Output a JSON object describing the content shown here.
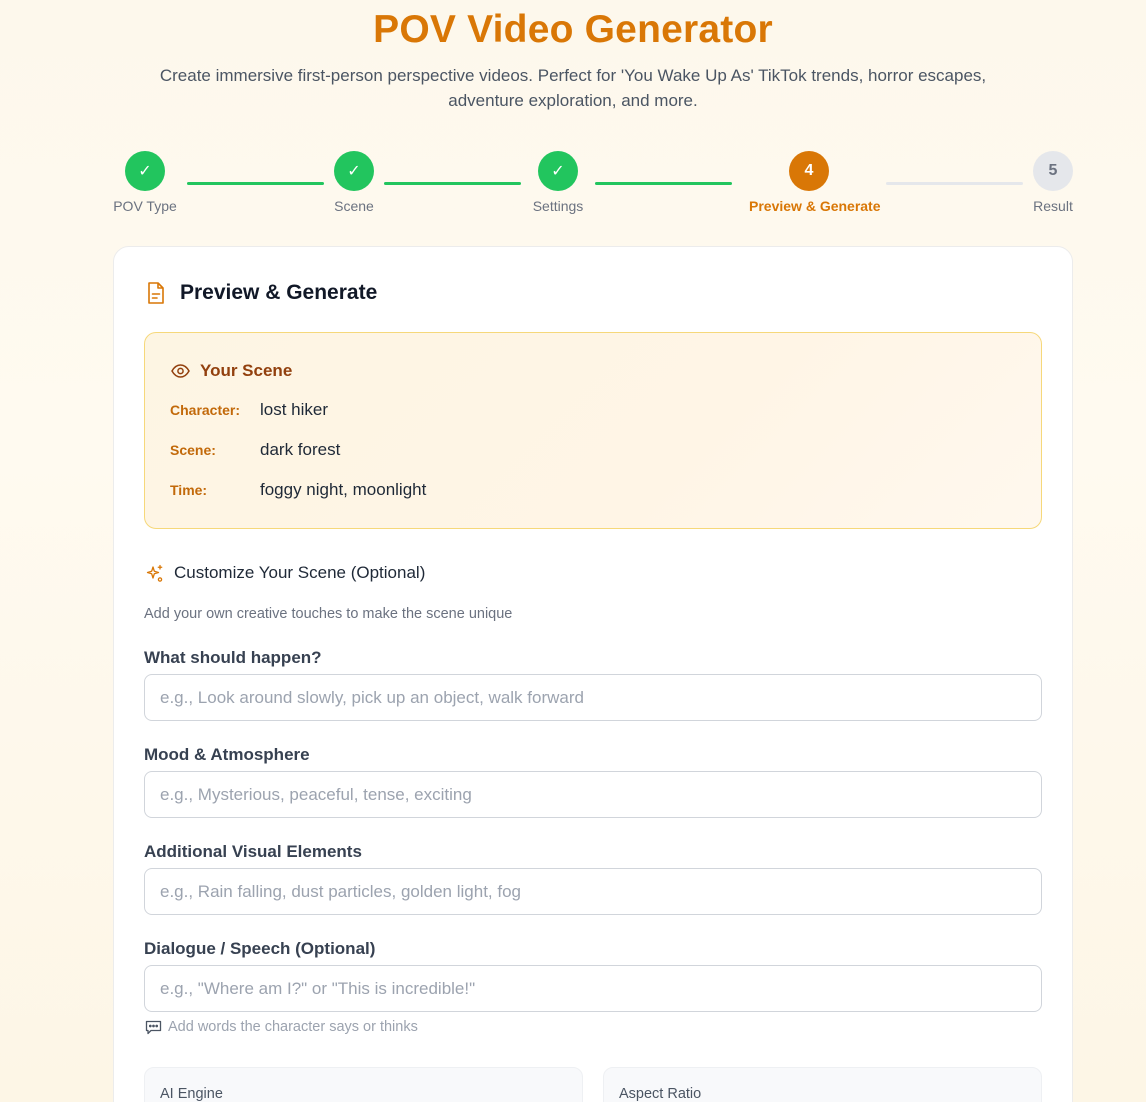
{
  "header": {
    "title": "POV Video Generator",
    "subtitle": "Create immersive first-person perspective videos. Perfect for 'You Wake Up As' TikTok trends, horror escapes, adventure exploration, and more."
  },
  "steps": [
    {
      "label": "POV Type",
      "marker": "✓",
      "state": "done"
    },
    {
      "label": "Scene",
      "marker": "✓",
      "state": "done"
    },
    {
      "label": "Settings",
      "marker": "✓",
      "state": "done"
    },
    {
      "label": "Preview & Generate",
      "marker": "4",
      "state": "active"
    },
    {
      "label": "Result",
      "marker": "5",
      "state": "todo"
    }
  ],
  "card": {
    "title": "Preview & Generate",
    "icon": "document-icon"
  },
  "scene_summary": {
    "title": "Your Scene",
    "icon": "eye-icon",
    "rows": [
      {
        "key": "Character:",
        "value": "lost hiker"
      },
      {
        "key": "Scene:",
        "value": "dark forest"
      },
      {
        "key": "Time:",
        "value": "foggy night, moonlight"
      }
    ]
  },
  "customize": {
    "title": "Customize Your Scene (Optional)",
    "icon": "sparkles-icon",
    "description": "Add your own creative touches to make the scene unique"
  },
  "fields": [
    {
      "label": "What should happen?",
      "value": "",
      "placeholder": "e.g., Look around slowly, pick up an object, walk forward"
    },
    {
      "label": "Mood & Atmosphere",
      "value": "",
      "placeholder": "e.g., Mysterious, peaceful, tense, exciting"
    },
    {
      "label": "Additional Visual Elements",
      "value": "",
      "placeholder": "e.g., Rain falling, dust particles, golden light, fog"
    },
    {
      "label": "Dialogue / Speech (Optional)",
      "value": "",
      "placeholder": "e.g., \"Where am I?\" or \"This is incredible!\""
    }
  ],
  "dialogue_hint": {
    "icon": "speech-bubble-icon",
    "text": "Add words the character says or thinks"
  },
  "options": [
    {
      "label": "AI Engine"
    },
    {
      "label": "Aspect Ratio"
    }
  ],
  "colors": {
    "accent": "#d97706",
    "done": "#22c55e",
    "pending": "#e5e7eb"
  }
}
